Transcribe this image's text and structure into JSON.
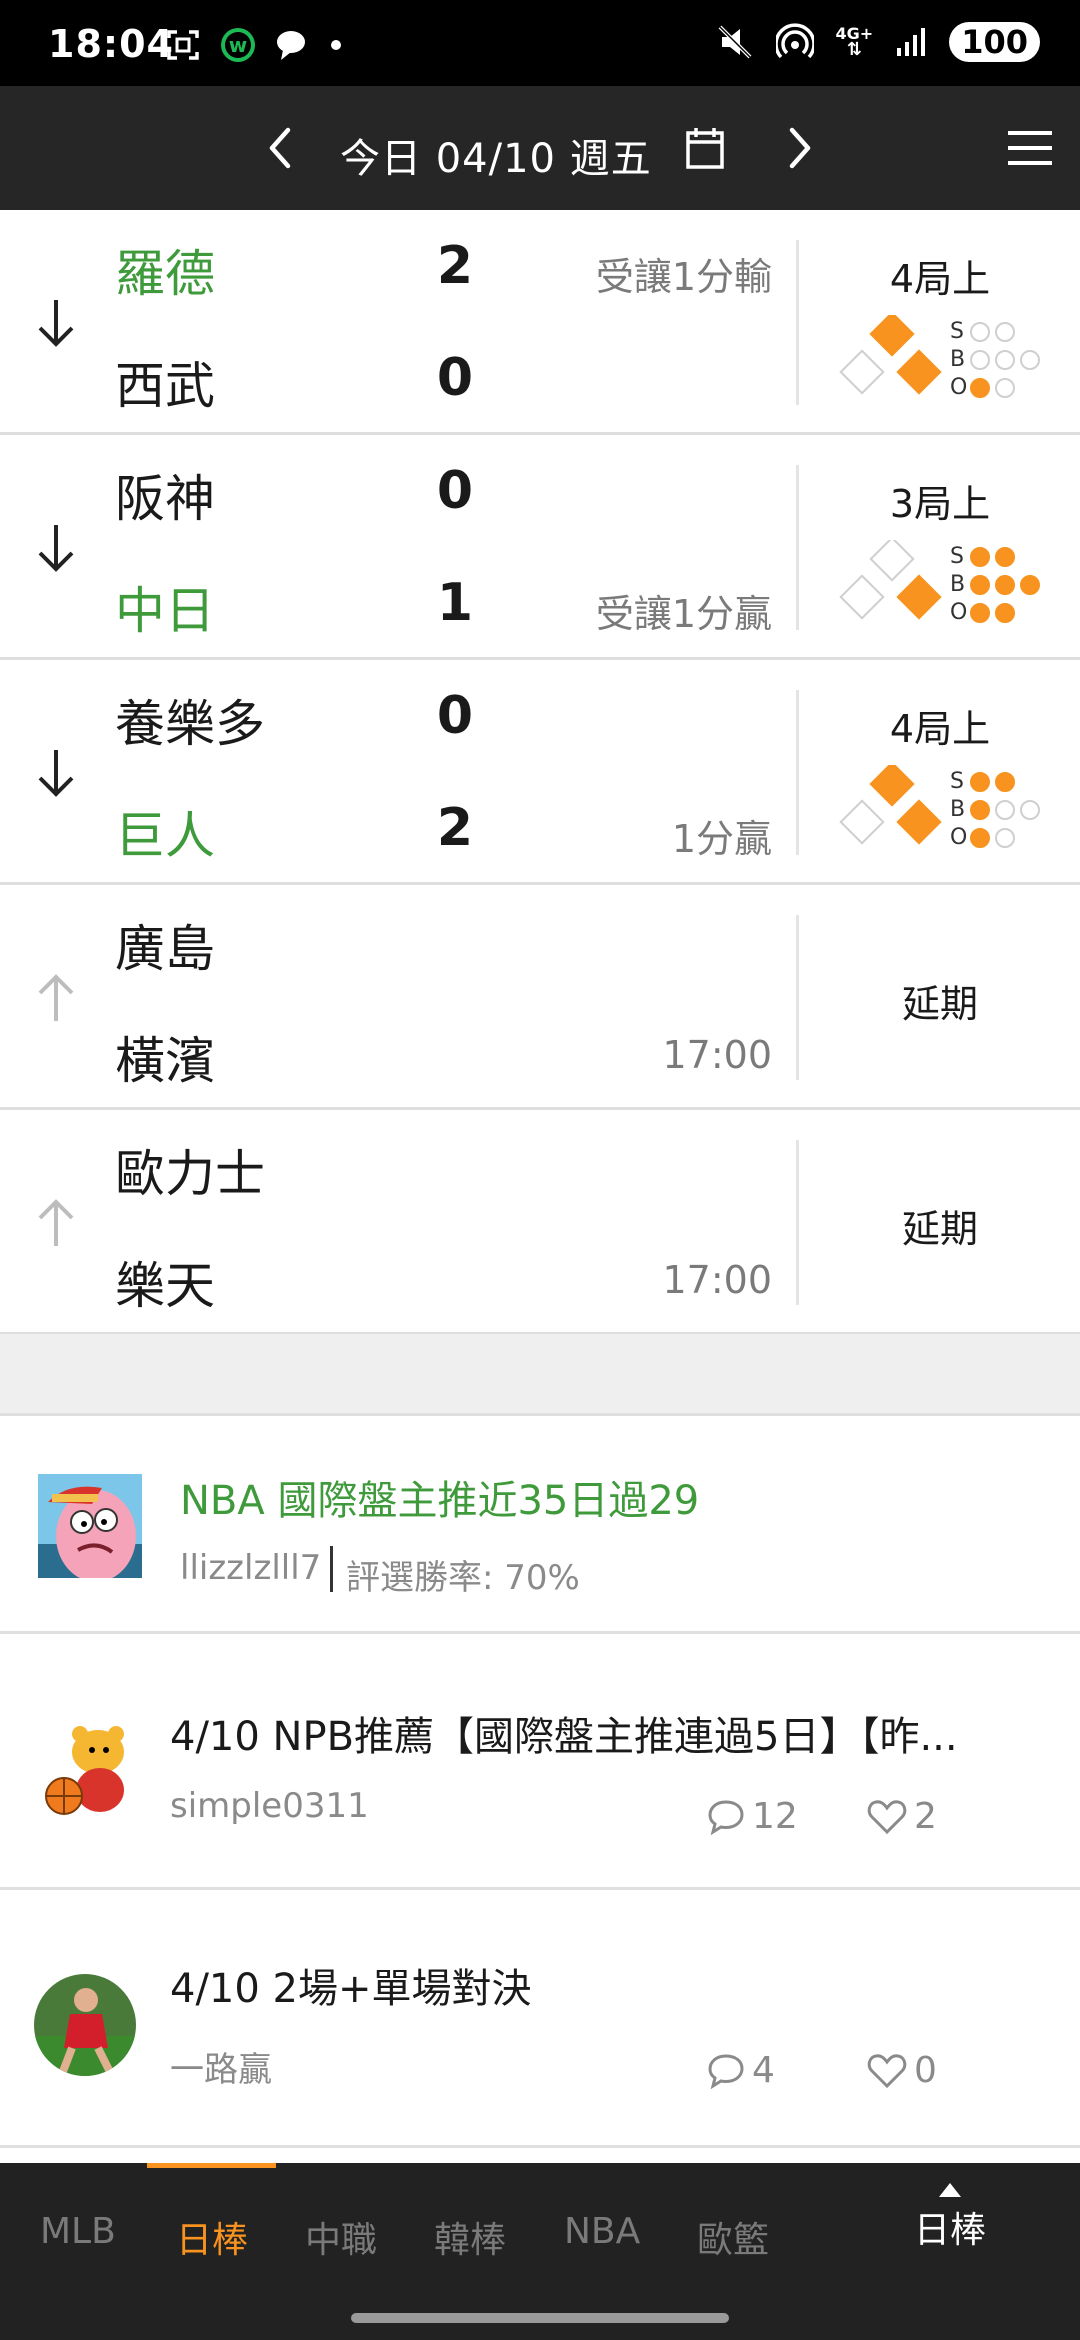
{
  "status_bar": {
    "time": "18:04",
    "network": "4G+",
    "battery": "100",
    "left_icons": [
      "screenshot-icon",
      "app-w-icon",
      "chat-bubble-icon",
      "dot-icon"
    ],
    "right_icons": [
      "mute-icon",
      "hotspot-icon",
      "network-icon",
      "signal-icon",
      "battery-icon"
    ]
  },
  "header": {
    "title": "今日 04/10 週五",
    "prev_icon": "chevron-left-icon",
    "calendar_icon": "calendar-icon",
    "next_icon": "chevron-right-icon",
    "menu_icon": "hamburger-menu-icon"
  },
  "games": [
    {
      "arrow": "down",
      "away": {
        "name": "羅德",
        "score": "2",
        "highlight": true
      },
      "home": {
        "name": "西武",
        "score": "0",
        "highlight": false
      },
      "note_top": "受讓1分輸",
      "note_bottom": "",
      "inning": "4局上",
      "status": "",
      "bases": {
        "first": true,
        "second": true,
        "third": false
      },
      "count": {
        "s": 0,
        "b": 0,
        "o": 1
      }
    },
    {
      "arrow": "down",
      "away": {
        "name": "阪神",
        "score": "0",
        "highlight": false
      },
      "home": {
        "name": "中日",
        "score": "1",
        "highlight": true
      },
      "note_top": "",
      "note_bottom": "受讓1分贏",
      "inning": "3局上",
      "status": "",
      "bases": {
        "first": true,
        "second": false,
        "third": false
      },
      "count": {
        "s": 2,
        "b": 3,
        "o": 2
      }
    },
    {
      "arrow": "down",
      "away": {
        "name": "養樂多",
        "score": "0",
        "highlight": false
      },
      "home": {
        "name": "巨人",
        "score": "2",
        "highlight": true
      },
      "note_top": "",
      "note_bottom": "1分贏",
      "inning": "4局上",
      "status": "",
      "bases": {
        "first": true,
        "second": true,
        "third": false
      },
      "count": {
        "s": 2,
        "b": 1,
        "o": 1
      }
    },
    {
      "arrow": "up",
      "away": {
        "name": "廣島",
        "score": "",
        "highlight": false
      },
      "home": {
        "name": "橫濱",
        "score": "",
        "highlight": false
      },
      "note_top": "",
      "note_bottom": "17:00",
      "inning": "",
      "status": "延期"
    },
    {
      "arrow": "up",
      "away": {
        "name": "歐力士",
        "score": "",
        "highlight": false
      },
      "home": {
        "name": "樂天",
        "score": "",
        "highlight": false
      },
      "note_top": "",
      "note_bottom": "17:00",
      "inning": "",
      "status": "延期"
    }
  ],
  "posts": [
    {
      "title": "NBA 國際盤主推近35日過29",
      "author": "llizzlzlll7",
      "meta": "評選勝率: 70%",
      "avatar": "cartoon-starfish-avatar",
      "highlight": true
    },
    {
      "title": "4/10 NPB推薦【國際盤主推連過5日】【昨...",
      "author": "simple0311",
      "comments": "12",
      "likes": "2",
      "avatar": "bear-basketball-avatar"
    },
    {
      "title": "4/10 2場+單場對決",
      "author": "一路贏",
      "comments": "4",
      "likes": "0",
      "avatar": "soccer-player-avatar"
    }
  ],
  "bottom_nav": {
    "tabs": [
      "MLB",
      "日棒",
      "中職",
      "韓棒",
      "NBA",
      "歐籃"
    ],
    "active_tab": "日棒",
    "current_label": "日棒"
  },
  "colors": {
    "accent": "#f7931e",
    "win_green": "#3e9a3a",
    "header_bg": "#262626",
    "nav_bg": "#222222"
  }
}
